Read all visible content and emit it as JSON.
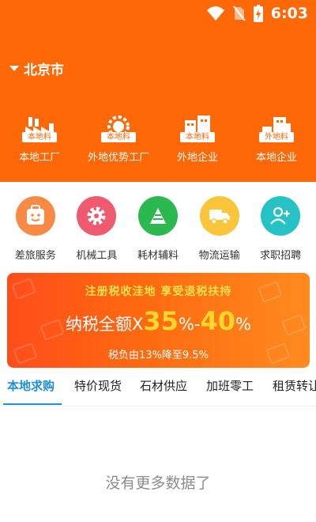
{
  "status_bar": {
    "time": "6:03"
  },
  "location": {
    "city": "北京市"
  },
  "top_categories": [
    {
      "label": "本地工厂",
      "badge": "本地料"
    },
    {
      "label": "外地优势工厂",
      "badge": "本地料"
    },
    {
      "label": "外地企业",
      "badge": "本地料"
    },
    {
      "label": "本地企业",
      "badge": "外地料"
    }
  ],
  "services": [
    {
      "label": "差旅服务",
      "icon": "smile-face-icon",
      "color": "#f98a45"
    },
    {
      "label": "机械工具",
      "icon": "gear-icon",
      "color": "#ef5a6e"
    },
    {
      "label": "耗材辅料",
      "icon": "stack-icon",
      "color": "#2bb84f"
    },
    {
      "label": "物流运输",
      "icon": "truck-icon",
      "color": "#fbc53a"
    },
    {
      "label": "求职招聘",
      "icon": "add-user-icon",
      "color": "#27c2c6"
    }
  ],
  "banner": {
    "top": "注册税收洼地 享受退税扶持",
    "main_prefix": "纳税全额X",
    "num1": "35",
    "pct1": "%-",
    "num2": "40",
    "pct2": "%",
    "sub": "税负由13%降至9.5%"
  },
  "tabs": [
    "本地求购",
    "特价现货",
    "石材供应",
    "加班零工",
    "租赁转让"
  ],
  "empty_text": "没有更多数据了",
  "colors": {
    "header": "#fe6807",
    "accent": "#1f8fdc"
  }
}
